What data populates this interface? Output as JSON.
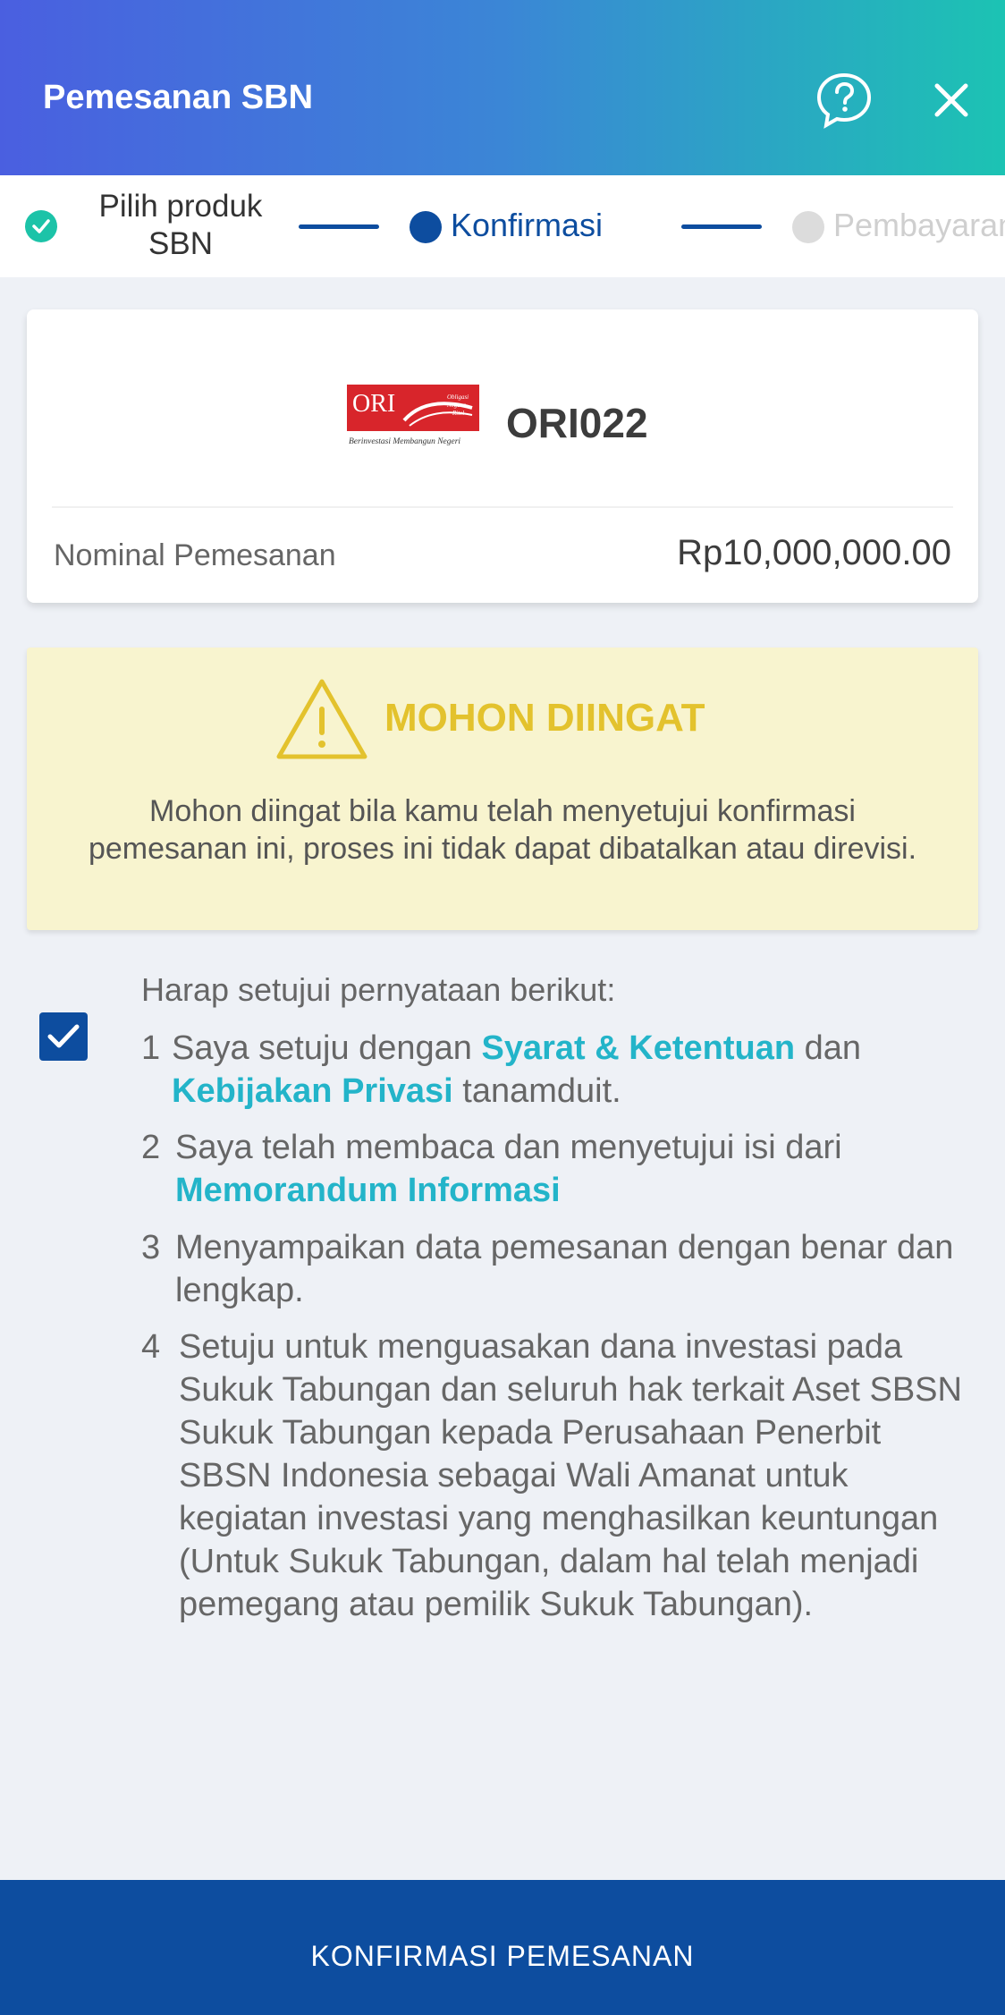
{
  "header": {
    "title": "Pemesanan SBN",
    "help_icon": "question-circle-icon",
    "close_icon": "close-icon"
  },
  "stepper": {
    "step1_label": "Pilih produk SBN",
    "step2_label": "Konfirmasi",
    "step3_label": "Pembayaran"
  },
  "product": {
    "logo_text": "ORI",
    "logo_subtext": "Obligasi Negara Ritel",
    "logo_tagline": "Berinvestasi Membangun Negeri",
    "name": "ORI022",
    "nominal_label": "Nominal Pemesanan",
    "nominal_value": "Rp10,000,000.00"
  },
  "warning": {
    "title": "MOHON DIINGAT",
    "text": "Mohon diingat bila kamu telah menyetujui konfirmasi pemesanan ini, proses ini tidak dapat dibatalkan atau direvisi."
  },
  "agreement": {
    "checked": true,
    "title": "Harap setujui pernyataan berikut:",
    "items": [
      {
        "num": "1",
        "text_a": "Saya setuju dengan ",
        "link_a": "Syarat & Ketentuan",
        "text_b": " dan",
        "link_b": "Kebijakan Privasi",
        "text_c": " tanamduit."
      },
      {
        "num": "2",
        "text_a": "Saya telah membaca dan menyetujui isi dari",
        "link_a": "Memorandum Informasi"
      },
      {
        "num": "3",
        "text_a": "Menyampaikan data pemesanan dengan benar dan lengkap."
      },
      {
        "num": "4",
        "text_a": "Setuju untuk menguasakan dana investasi pada Sukuk Tabungan dan seluruh hak terkait Aset SBSN Sukuk Tabungan kepada Perusahaan Penerbit SBSN Indonesia sebagai Wali Amanat untuk kegiatan investasi yang menghasilkan keuntungan (Untuk Sukuk Tabungan, dalam hal telah menjadi pemegang atau pemilik Sukuk Tabungan)."
      }
    ]
  },
  "footer": {
    "confirm_label": "KONFIRMASI PEMESANAN"
  },
  "colors": {
    "primary": "#0d4d9f",
    "accent_link": "#23b4c9",
    "warning_title": "#e3c22d",
    "success": "#1cc3a8"
  }
}
